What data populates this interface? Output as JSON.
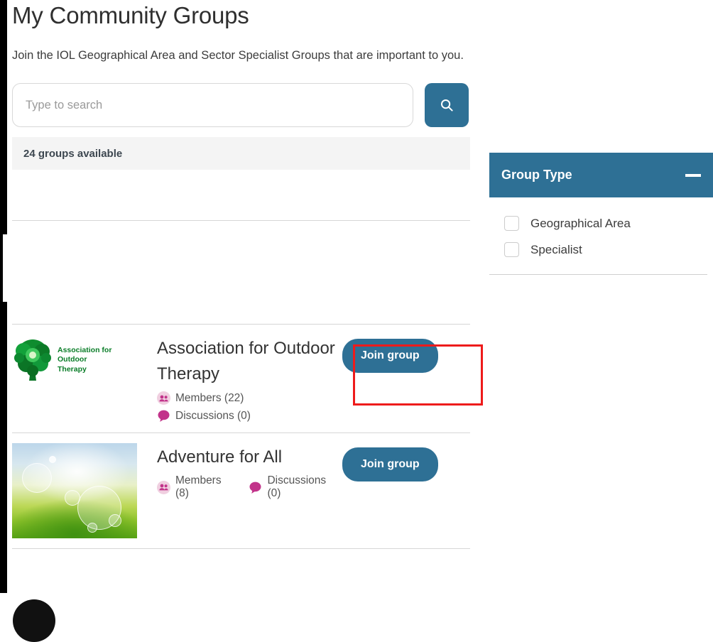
{
  "header": {
    "title": "My Community Groups",
    "intro": "Join the IOL Geographical Area and Sector Specialist Groups that are important to you."
  },
  "search": {
    "placeholder": "Type to search",
    "value": "",
    "button_icon": "search-icon"
  },
  "results": {
    "count_text": "24 groups available"
  },
  "groups": [
    {
      "name": "Association for Outdoor Therapy",
      "logo_text_lines": [
        "Association for",
        "Outdoor",
        "Therapy"
      ],
      "members_label": "Members (22)",
      "discussions_label": "Discussions (0)",
      "join_label": "Join group",
      "highlighted": true
    },
    {
      "name": "Adventure for All",
      "members_label": "Members (8)",
      "discussions_label": "Discussions (0)",
      "join_label": "Join group",
      "highlighted": false
    }
  ],
  "filter": {
    "title": "Group Type",
    "collapse_icon": "minus-icon",
    "options": [
      {
        "label": "Geographical Area",
        "checked": false
      },
      {
        "label": "Specialist",
        "checked": false
      }
    ]
  },
  "colors": {
    "accent_teal": "#2e7095",
    "highlight_red": "#ee1b1b",
    "count_bar_bg": "#f4f4f4",
    "logo_green": "#0a7d28",
    "meta_pink": "#c2338a"
  }
}
